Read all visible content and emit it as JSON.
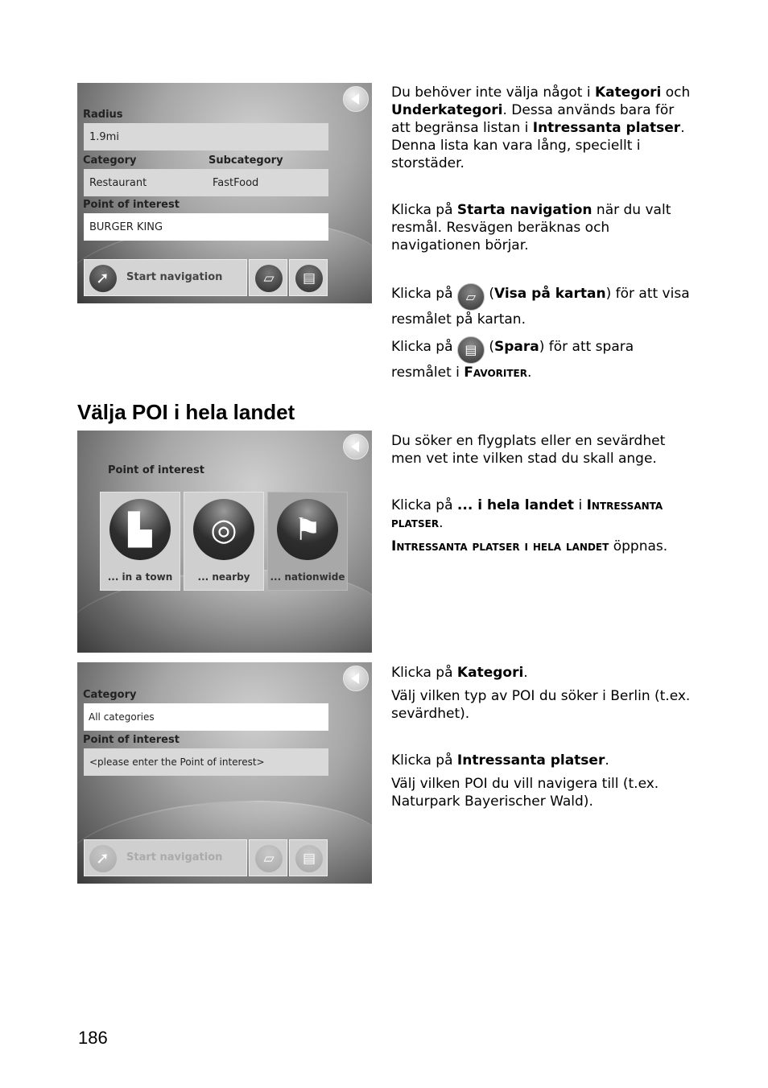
{
  "screen1": {
    "radius_label": "Radius",
    "radius_value": "1.9mi",
    "category_label": "Category",
    "subcategory_label": "Subcategory",
    "category_value": "Restaurant",
    "subcategory_value": "FastFood",
    "poi_label": "Point of interest",
    "poi_value": "BURGER KING",
    "start_nav_label": "Start navigation"
  },
  "text1": {
    "p1": [
      {
        "t": "Du behöver inte välja något i "
      },
      {
        "t": "Kategori",
        "b": true
      },
      {
        "t": " och "
      },
      {
        "t": "Underkategori",
        "b": true
      },
      {
        "t": ". Dessa används bara för att begränsa listan i "
      },
      {
        "t": "Intressanta platser",
        "b": true
      },
      {
        "t": ". Denna lista kan vara lång, speciellt i storstäder."
      }
    ],
    "p2": [
      {
        "t": "Klicka på "
      },
      {
        "t": "Starta navigation",
        "b": true
      },
      {
        "t": " när du valt resmål. Resvägen beräknas och navigationen börjar."
      }
    ],
    "p3_pre": "Klicka på ",
    "p3_bold": "Visa på kartan",
    "p3_post": ") för att visa resmålet på kartan.",
    "p4_pre": "Klicka på ",
    "p4_bold": "Spara",
    "p4_post": ") för att spara resmålet i ",
    "p4_sc": "Favoriter",
    "p4_end": "."
  },
  "section_title": "Välja POI i hela landet",
  "screen2": {
    "poi_label": "Point of interest",
    "tiles": [
      {
        "label": "... in a town",
        "icon": "city-icon"
      },
      {
        "label": "... nearby",
        "icon": "target-icon"
      },
      {
        "label": "... nationwide",
        "icon": "flags-icon"
      }
    ]
  },
  "text2": {
    "p1": "Du söker en flygplats eller en sevärdhet men vet inte vilken stad du skall ange.",
    "p2_pre": "Klicka på ",
    "p2_bold": "... i hela landet",
    "p2_mid": " i ",
    "p2_sc": "Intressanta platser",
    "p2_end": ".",
    "p3_sc": "Intressanta platser i hela landet",
    "p3_post": " öppnas."
  },
  "screen3": {
    "category_label": "Category",
    "category_value": "All categories",
    "poi_label": "Point of interest",
    "poi_placeholder": "<please enter the Point of interest>",
    "start_nav_label": "Start navigation"
  },
  "text3": {
    "p1_pre": "Klicka på ",
    "p1_bold": "Kategori",
    "p1_end": ".",
    "p2": "Välj vilken typ av POI du söker i Berlin (t.ex. sevärdhet).",
    "p3_pre": "Klicka på ",
    "p3_bold": "Intressanta platser",
    "p3_end": ".",
    "p4": "Välj vilken POI du vill navigera till (t.ex. Naturpark Bayerischer Wald)."
  },
  "page_number": "186"
}
